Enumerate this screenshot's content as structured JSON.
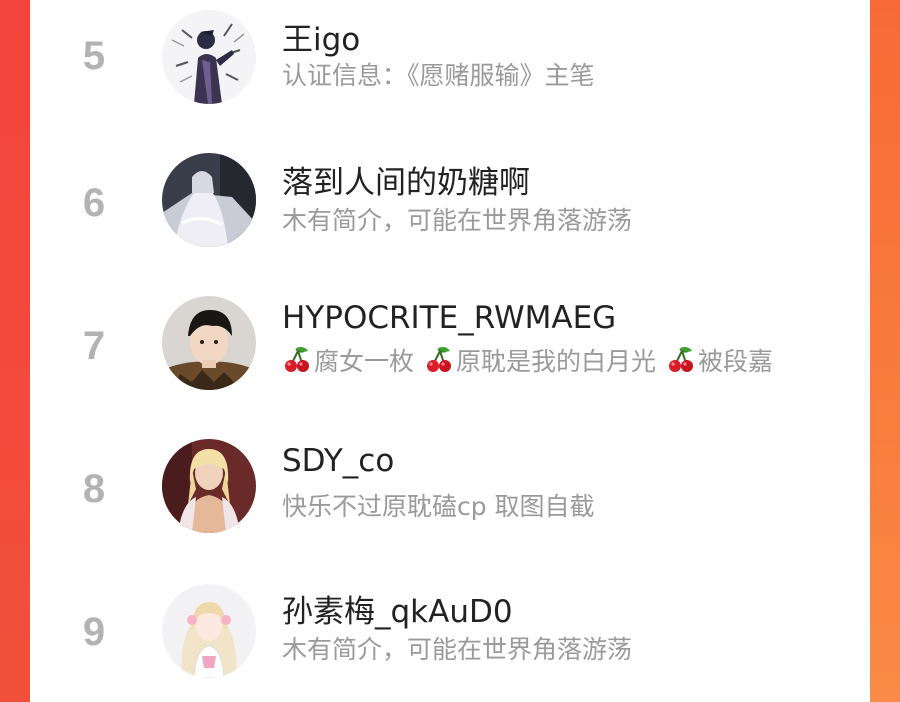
{
  "ranking": {
    "rows": [
      {
        "rank": "5",
        "name": "王igo",
        "bio": "认证信息：《愿赌服输》主笔",
        "avatar_icon": "ink-sketch-character-avatar"
      },
      {
        "rank": "6",
        "name": "落到人间的奶糖啊",
        "bio": "木有简介，可能在世界角落游荡",
        "avatar_icon": "white-dress-figure-avatar"
      },
      {
        "rank": "7",
        "name": "HYPOCRITE_RWMAEG",
        "bio_segments": [
          "腐女一枚",
          "原耽是我的白月光",
          "被段嘉"
        ],
        "avatar_icon": "young-man-portrait-avatar",
        "bio_icon": "cherry-icon"
      },
      {
        "rank": "8",
        "name": "SDY_co",
        "bio": "快乐不过原耽磕cp 取图自截",
        "avatar_icon": "blonde-character-avatar"
      },
      {
        "rank": "9",
        "name": "孙素梅_qkAuD0",
        "bio": "木有简介，可能在世界角落游荡",
        "avatar_icon": "anime-girl-avatar"
      }
    ]
  },
  "colors": {
    "rank_text": "#b3b3b3",
    "name_text": "#222222",
    "bio_text": "#9a9a9a",
    "edge_left": "#f24a3c",
    "edge_right": "#f97c3b"
  }
}
